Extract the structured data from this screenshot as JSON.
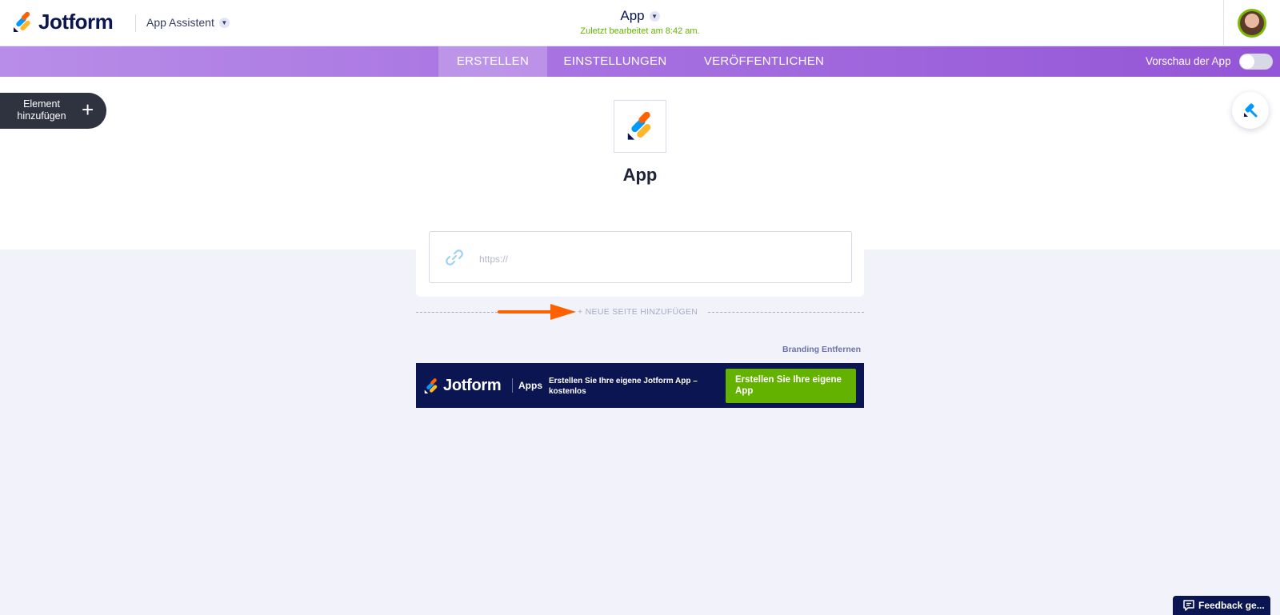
{
  "header": {
    "logo_text": "Jotform",
    "assistant_label": "App Assistent",
    "app_title": "App",
    "last_edited": "Zuletzt bearbeitet am 8:42 am."
  },
  "nav": {
    "tabs": [
      {
        "label": "ERSTELLEN",
        "active": true
      },
      {
        "label": "EINSTELLUNGEN",
        "active": false
      },
      {
        "label": "VERÖFFENTLICHEN",
        "active": false
      }
    ],
    "preview_label": "Vorschau der App",
    "preview_enabled": false
  },
  "sidebar": {
    "add_element_label": "Element hinzufügen",
    "add_element_icon": "+"
  },
  "app": {
    "name": "App"
  },
  "link_field": {
    "placeholder": "https://"
  },
  "page_actions": {
    "add_page_label": "+ NEUE SEITE HINZUFÜGEN"
  },
  "branding": {
    "remove_label": "Branding Entfernen",
    "banner_logo_text": "Jotform",
    "banner_apps_label": "Apps",
    "banner_text": "Erstellen Sie Ihre eigene Jotform App – kostenlos",
    "banner_cta": "Erstellen Sie Ihre eigene App"
  },
  "feedback": {
    "label": "Feedback ge..."
  },
  "colors": {
    "brand_navy": "#0a1551",
    "nav_purple": "#a56fe0",
    "accent_green": "#64b200",
    "arrow_orange": "#ff6100"
  }
}
